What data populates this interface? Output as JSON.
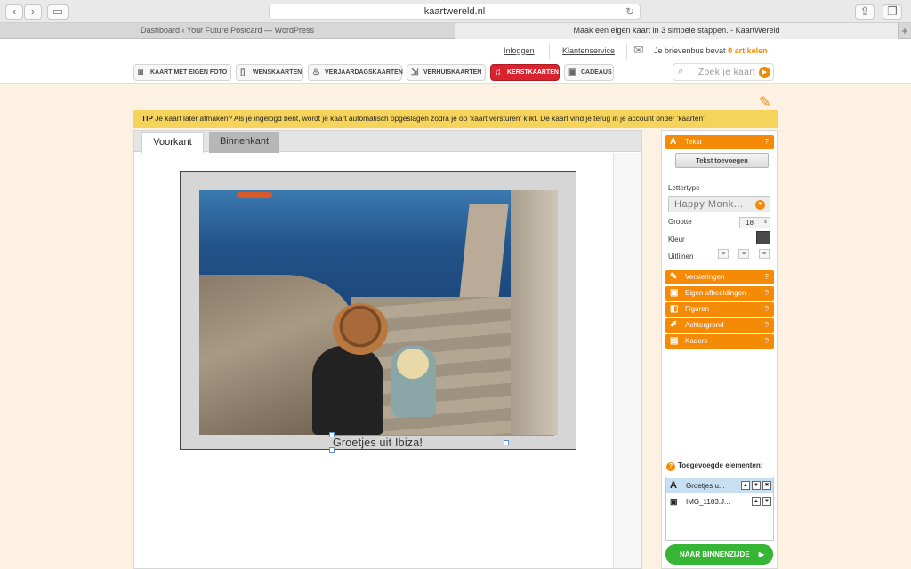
{
  "browser": {
    "url": "kaartwereld.nl",
    "tabs": [
      {
        "label": "Dashboard ‹ Your Future Postcard — WordPress"
      },
      {
        "label": "Maak een eigen kaart in 3 simpele stappen. - KaartWereld"
      }
    ]
  },
  "header": {
    "login": "Inloggen",
    "service": "Klantenservice",
    "mailbox_text": "Je brievenbus bevat",
    "mailbox_count": "0 artikelen"
  },
  "categories": [
    {
      "label": "KAART MET EIGEN FOTO",
      "icon": "camera-icon"
    },
    {
      "label": "WENSKAARTEN",
      "icon": "card-icon"
    },
    {
      "label": "VERJAARDAGSKAARTEN",
      "icon": "cake-icon"
    },
    {
      "label": "VERHUISKAARTEN",
      "icon": "move-icon"
    },
    {
      "label": "KERSTKAARTEN",
      "icon": "bell-icon",
      "active": true
    },
    {
      "label": "CADEAUS",
      "icon": "gift-icon"
    }
  ],
  "search": {
    "placeholder": "Zoek je kaart"
  },
  "tip": {
    "label": "TIP",
    "text": "Je kaart later afmaken? Als je ingelogd bent, wordt je kaart automatisch opgeslagen zodra je op 'kaart versturen' klikt. De kaart vind je terug in je account onder 'kaarten'."
  },
  "editor": {
    "tab_front": "Voorkant",
    "tab_back": "Binnenkant",
    "caption": "Groetjes uit Ibiza!"
  },
  "panel": {
    "text_header": "Tekst",
    "add_text": "Tekst toevoegen",
    "font_label": "Lettertype",
    "font_value": "Happy Monk...",
    "size_label": "Grootte",
    "size_value": "18",
    "color_label": "Kleur",
    "align_label": "Uitlijnen",
    "sections": [
      "Versieringen",
      "Eigen afbeeldingen",
      "Figuren",
      "Achtergrond",
      "Kaders"
    ],
    "help": "?",
    "added_header": "Toegevoegde elementen:",
    "elements": [
      {
        "label": "Groetjes u..."
      },
      {
        "label": "IMG_1183.J..."
      }
    ],
    "next_button": "NAAR BINNENZIJDE"
  },
  "colors": {
    "accent": "#f58a07",
    "active_category": "#d9232e",
    "tip": "#f6d45c",
    "next": "#37b534"
  }
}
